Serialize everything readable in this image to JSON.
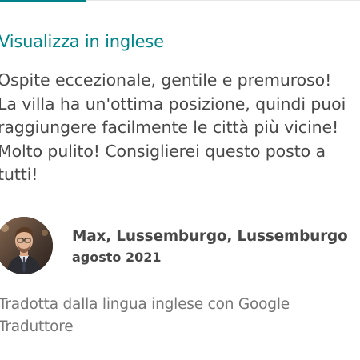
{
  "review": {
    "translate_link": "Visualizza in inglese",
    "text": "Ospite eccezionale, gentile e premuroso!\nLa villa ha un'ottima posizione, quindi puoi\nraggiungere facilmente le città più vicine!\nMolto pulito! Consiglierei questo posto a\ntutti!",
    "author": {
      "name": "Max, Lussemburgo, Lussemburgo",
      "date": "agosto 2021",
      "avatar_icon": "person-photo"
    },
    "translation_note": "Tradotta dalla lingua inglese con Google Traduttore"
  },
  "colors": {
    "accent": "#008489",
    "text": "#484848",
    "muted": "#767676"
  }
}
